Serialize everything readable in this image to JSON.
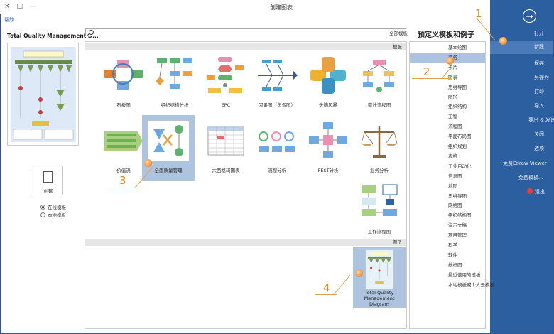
{
  "window": {
    "title": "创建图表",
    "controls": [
      "×",
      "□",
      "—"
    ],
    "help_link": "帮助"
  },
  "sidebar": {
    "back_icon": "arrow-right-circle-icon",
    "items": [
      {
        "label": "打开",
        "active": false
      },
      {
        "label": "新建",
        "active": true
      },
      {
        "label": "保存",
        "active": false
      },
      {
        "label": "另存为",
        "active": false
      },
      {
        "label": "打印",
        "active": false
      },
      {
        "label": "导入",
        "active": false
      },
      {
        "label": "导出 & 发送",
        "active": false
      },
      {
        "label": "关闭",
        "active": false
      },
      {
        "label": "选项",
        "active": false
      },
      {
        "label": "免费Edraw Viewer",
        "active": false
      },
      {
        "label": "免费模板...",
        "active": false
      },
      {
        "label": "退出",
        "active": false
      }
    ]
  },
  "preview": {
    "title": "Total Quality Management D...",
    "create_label": "创建",
    "radio_options": [
      {
        "label": "在线模板",
        "checked": true
      },
      {
        "label": "本地模板",
        "checked": false
      }
    ]
  },
  "search": {
    "placeholder": "",
    "label": "全部模板"
  },
  "categories": {
    "title": "预定义模板和例子",
    "items": [
      {
        "label": "基本绘图",
        "selected": false
      },
      {
        "label": "商务",
        "selected": true
      },
      {
        "label": "卡片",
        "selected": false
      },
      {
        "label": "图表",
        "selected": false
      },
      {
        "label": "思维导图",
        "selected": false
      },
      {
        "label": "图形",
        "selected": false
      },
      {
        "label": "组织结构",
        "selected": false
      },
      {
        "label": "工程",
        "selected": false
      },
      {
        "label": "流程图",
        "selected": false
      },
      {
        "label": "平面布局图",
        "selected": false
      },
      {
        "label": "组织规划",
        "selected": false
      },
      {
        "label": "表格",
        "selected": false
      },
      {
        "label": "工业自动化",
        "selected": false
      },
      {
        "label": "信息图",
        "selected": false
      },
      {
        "label": "地图",
        "selected": false
      },
      {
        "label": "思维导图",
        "selected": false
      },
      {
        "label": "网络图",
        "selected": false
      },
      {
        "label": "组织结构图",
        "selected": false
      },
      {
        "label": "演示文稿",
        "selected": false
      },
      {
        "label": "项目管理",
        "selected": false
      },
      {
        "label": "科学",
        "selected": false
      },
      {
        "label": "软件",
        "selected": false
      },
      {
        "label": "线框图",
        "selected": false
      },
      {
        "label": "最近使用的模板",
        "selected": false
      },
      {
        "label": "本地模板或个人云模板",
        "selected": false
      }
    ]
  },
  "sections": {
    "templates_header": "模板",
    "examples_header": "例子"
  },
  "templates": [
    {
      "label": "审计流程图",
      "selected": false
    },
    {
      "label": "头脑风暴",
      "selected": false
    },
    {
      "label": "因果图（鱼骨图）",
      "selected": false
    },
    {
      "label": "EPC",
      "selected": false
    },
    {
      "label": "组织结构分析",
      "selected": false
    },
    {
      "label": "石板图",
      "selected": false
    },
    {
      "label": "业务分析",
      "selected": false
    },
    {
      "label": "PEST分析",
      "selected": false
    },
    {
      "label": "流程分析",
      "selected": false
    },
    {
      "label": "六西格玛图表",
      "selected": false
    },
    {
      "label": "全面质量管理",
      "selected": true
    },
    {
      "label": "价值流",
      "selected": false
    },
    {
      "label": "工作流程图",
      "selected": false
    }
  ],
  "examples": [
    {
      "label": "Total Quality Management Diagram",
      "selected": true
    }
  ],
  "callouts": [
    "1",
    "2",
    "3",
    "4"
  ],
  "colors": {
    "sidebar": "#2c5fa0",
    "selection": "#aec3de",
    "callout": "#f08a30"
  }
}
